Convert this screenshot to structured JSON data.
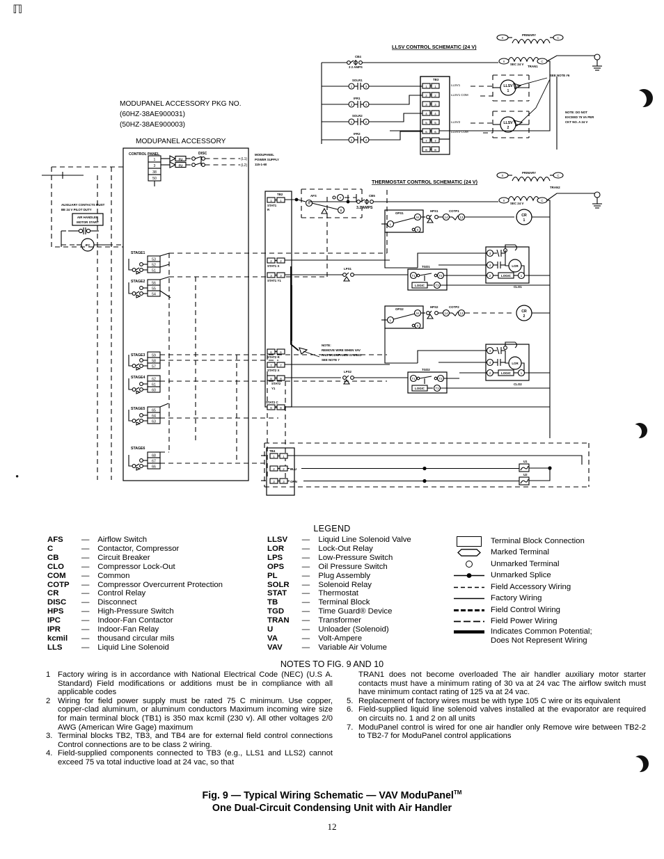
{
  "schematic": {
    "modupanel_pkg": {
      "line1": "MODUPANEL ACCESSORY PKG NO.",
      "line2": "(60HZ-38AE900031)",
      "line3": "(50HZ-38AE900003)"
    },
    "modupanel_accessory_title": "MODUPANEL ACCESSORY",
    "control_panel_label": "CONTROL PANEL",
    "disc_label": "DISC",
    "fu_label": "FU",
    "l1_label": "(L1)",
    "l2_label": "(L2)",
    "power_supply": {
      "line1": "MODUPANEL",
      "line2": "POWER SUPPLY",
      "line3": "115-1-60"
    },
    "control_panel_terminals": [
      "1",
      "3",
      "38",
      "50"
    ],
    "aux_note": "AUXILIARY CONTACTS MUST BE 24 V PILOT DUTY",
    "air_handler_label_1": "AIR HANDLER",
    "air_handler_label_2": "MOTOR START",
    "ifc_label": "IFC",
    "stages": [
      {
        "name": "STAGE1",
        "terminals": [
          "53",
          "52",
          "51"
        ]
      },
      {
        "name": "STAGE2",
        "terminals": [
          "56",
          "55",
          "54"
        ]
      },
      {
        "name": "STAGE3",
        "terminals": [
          "59",
          "58",
          "57"
        ]
      },
      {
        "name": "STAGE4",
        "terminals": [
          "62",
          "61",
          "60"
        ]
      },
      {
        "name": "STAGE5",
        "terminals": [
          "65",
          "64",
          "63"
        ]
      },
      {
        "name": "STAGE6",
        "terminals": [
          "68",
          "67",
          "66"
        ]
      }
    ],
    "llsv_schematic_title": "LLSV CONTROL SCHEMATIC (24 V)",
    "thermostat_schematic_title": "THERMOSTAT CONTROL SCHEMATIC (24 V)",
    "cb4_label": "CB4",
    "cb4_amps": "3 2 AMPS",
    "cb5_label": "CB5",
    "cb5_amps": "3.2 AMPS",
    "primary_label": "PRIMARY",
    "sec_label": "SEC 24 V",
    "tran1_label": "TRAN1",
    "tran2_label": "TRAN2",
    "x_label": "X",
    "c_label": "C",
    "llsv_rows": [
      {
        "relay": "SOLR1",
        "a": "1",
        "b": "3"
      },
      {
        "relay": "IFR1",
        "a": "2",
        "b": "4"
      },
      {
        "relay": "SOLR2",
        "a": "1",
        "b": "2"
      },
      {
        "relay": "IFR2",
        "a": "2",
        "b": "4"
      }
    ],
    "tb3_label": "TB3",
    "tb3_terminals": [
      "1",
      "2",
      "3",
      "4",
      "5",
      "6",
      "7",
      "8"
    ],
    "llsv1_label": "LLSV1",
    "llsv1_com_label": "LLSV1 COM",
    "llsv2_label": "LLSV2",
    "llsv2_com_label": "LLSV2 COM",
    "llsv1_coil": "LLSV",
    "llsv1_coil_num": "1",
    "llsv2_coil": "LLSV",
    "llsv2_coil_num": "2",
    "see_note_6": "SEE NOTE #6",
    "va_note": "NOTE: DO NOT\nEXCEED 75 VA PER\nCKT NO. A 24 V",
    "tb2_label": "TB2",
    "tb2_rows": [
      {
        "num": "1",
        "label": "STAT1\nR"
      },
      {
        "num": "2",
        "label": "STAT1  X"
      },
      {
        "num": "3",
        "label": "STAT1  Y1"
      },
      {
        "num": "6",
        "label": "STAT2  R"
      },
      {
        "num": "7",
        "label": "STAT2  X"
      },
      {
        "num": "8",
        "label": "STAT2\nY1"
      },
      {
        "num": "9",
        "label": "STAT2  C"
      }
    ],
    "afs_label": "AFS",
    "afs_r": "R",
    "afs_y": "Y",
    "afs_b": "B",
    "vav_note": "NOTE:\nREMOVE WIRE WHEN VAV\nAND MODUPANEL IS USED\nSEE NOTE 7",
    "circuit1": {
      "ops": "OPS1",
      "ops_l": "L",
      "ops_m": "M",
      "ops_s": "S",
      "hps": "HPS1",
      "cotp": "COTP1",
      "cotp_a": "14",
      "cotp_b": "13",
      "cr": "CR",
      "cr_num": "1",
      "lps": "LPS1",
      "tgd": "TGD1",
      "tgd_t1": "T1",
      "tgd_t2": "T2",
      "tgd_t3": "T3",
      "logic": "LOGIC",
      "lor": "LOR",
      "clo": "CLO1",
      "blk_a": "3",
      "blk_b": "4",
      "blk_c": "2",
      "blk_d": "1"
    },
    "circuit2": {
      "ops": "OPS2",
      "ops_l": "L",
      "ops_m": "M",
      "ops_s": "S",
      "hps": "HPS2",
      "cotp": "COTP2",
      "cotp_a": "14",
      "cotp_b": "13",
      "cr": "CR",
      "cr_num": "2",
      "lps": "LPS2",
      "tgd": "TGD2",
      "tgd_t1": "T1",
      "tgd_t2": "T2",
      "tgd_t3": "T3",
      "logic": "LOGIC",
      "lor": "LOR",
      "clo": "CLO2",
      "blk_a": "3",
      "blk_b": "4",
      "blk_c": "2",
      "blk_d": "1"
    },
    "tb4_label": "TB4",
    "tb4_terminals": [
      "1",
      "2",
      "3"
    ],
    "blu_label": "BLU",
    "orn_label": "ORN",
    "u1_label": "U1",
    "u2_label": "U2"
  },
  "legend": {
    "title": "LEGEND",
    "col1": [
      {
        "abbr": "AFS",
        "dash": "—",
        "term": "Airflow Switch"
      },
      {
        "abbr": "C",
        "dash": "—",
        "term": "Contactor, Compressor"
      },
      {
        "abbr": "CB",
        "dash": "—",
        "term": "Circuit Breaker"
      },
      {
        "abbr": "CLO",
        "dash": "—",
        "term": "Compressor Lock-Out"
      },
      {
        "abbr": "COM",
        "dash": "—",
        "term": "Common"
      },
      {
        "abbr": "COTP",
        "dash": "—",
        "term": "Compressor Overcurrent Protection"
      },
      {
        "abbr": "CR",
        "dash": "—",
        "term": "Control Relay"
      },
      {
        "abbr": "DISC",
        "dash": "—",
        "term": "Disconnect"
      },
      {
        "abbr": "HPS",
        "dash": "—",
        "term": "High-Pressure Switch"
      },
      {
        "abbr": "IPC",
        "dash": "—",
        "term": "Indoor-Fan Contactor"
      },
      {
        "abbr": "IPR",
        "dash": "—",
        "term": "Indoor-Fan Relay"
      },
      {
        "abbr": "kcmil",
        "dash": "—",
        "term": "thousand circular mils"
      },
      {
        "abbr": "LLS",
        "dash": "—",
        "term": "Liquid Line Solenoid"
      }
    ],
    "col2": [
      {
        "abbr": "LLSV",
        "dash": "—",
        "term": "Liquid Line Solenoid Valve"
      },
      {
        "abbr": "LOR",
        "dash": "—",
        "term": "Lock-Out Relay"
      },
      {
        "abbr": "LPS",
        "dash": "—",
        "term": "Low-Pressure Switch"
      },
      {
        "abbr": "OPS",
        "dash": "—",
        "term": "Oil Pressure Switch"
      },
      {
        "abbr": "PL",
        "dash": "—",
        "term": "Plug Assembly"
      },
      {
        "abbr": "SOLR",
        "dash": "—",
        "term": "Solenoid Relay"
      },
      {
        "abbr": "STAT",
        "dash": "—",
        "term": "Thermostat"
      },
      {
        "abbr": "TB",
        "dash": "—",
        "term": "Terminal Block"
      },
      {
        "abbr": "TGD",
        "dash": "—",
        "term": "Time Guard® Device"
      },
      {
        "abbr": "TRAN",
        "dash": "—",
        "term": "Transformer"
      },
      {
        "abbr": "U",
        "dash": "—",
        "term": "Unloader (Solenoid)"
      },
      {
        "abbr": "VA",
        "dash": "—",
        "term": "Volt-Ampere"
      },
      {
        "abbr": "VAV",
        "dash": "—",
        "term": "Variable Air Volume"
      }
    ],
    "symbols": [
      {
        "icon": "terminal-block-connection-icon",
        "label": "Terminal Block Connection"
      },
      {
        "icon": "marked-terminal-icon",
        "label": "Marked Terminal"
      },
      {
        "icon": "unmarked-terminal-icon",
        "label": "Unmarked Terminal"
      },
      {
        "icon": "unmarked-splice-icon",
        "label": "Unmarked Splice"
      },
      {
        "icon": "field-accessory-wiring-icon",
        "label": "Field Accessory Wiring"
      },
      {
        "icon": "factory-wiring-icon",
        "label": "Factory Wiring"
      },
      {
        "icon": "field-control-wiring-icon",
        "label": "Field Control Wiring"
      },
      {
        "icon": "field-power-wiring-icon",
        "label": "Field Power Wiring"
      },
      {
        "icon": "common-potential-icon",
        "label": "Indicates Common Potential;\nDoes Not Represent Wiring"
      }
    ]
  },
  "notes": {
    "heading": "NOTES TO FIG. 9 AND 10",
    "left": [
      {
        "num": "1",
        "text": "Factory wiring is in accordance with National Electrical Code (NEC) (U.S A. Standard) Field modifications or additions must be in compliance with all applicable codes"
      },
      {
        "num": "2",
        "text": "Wiring for field power supply must be rated 75 C minimum. Use copper, copper-clad aluminum, or aluminum conductors  Maximum incoming wire size for main terminal block (TB1) is 350 max kcmil (230 v). All other voltages 2/0 AWG (American Wire Gage) maximum"
      },
      {
        "num": "3.",
        "text": "Terminal blocks TB2, TB3, and TB4 are for external field control connections  Control connections are to be class 2 wiring."
      },
      {
        "num": "4.",
        "text": "Field-supplied components connected to TB3 (e.g., LLS1 and LLS2) cannot exceed 75 va total inductive load at 24 vac, so that"
      }
    ],
    "right_continuation": "TRAN1 does not become overloaded  The air handler auxiliary motor starter contacts must have a minimum rating of 30 va at 24 vac  The airflow switch must have minimum contact rating of 125 va at 24 vac.",
    "right": [
      {
        "num": "5.",
        "text": "Replacement of factory wires must be with type 105 C wire or its equivalent"
      },
      {
        "num": "6.",
        "text": "Field-supplied liquid line solenoid valves installed at the evaporator are required on circuits no. 1 and 2 on all units"
      },
      {
        "num": "7.",
        "text": "ModuPanel control is wired for one air handler only  Remove wire between TB2-2 to TB2-7 for ModuPanel control applications"
      }
    ]
  },
  "caption": {
    "line1_a": "Fig. 9 ",
    "line1_b": "— Typical Wiring Schematic — VAV ModuPanel",
    "trademark": "TM",
    "line2": "One Dual-Circuit Condensing Unit with Air Handler"
  },
  "folio": "12"
}
